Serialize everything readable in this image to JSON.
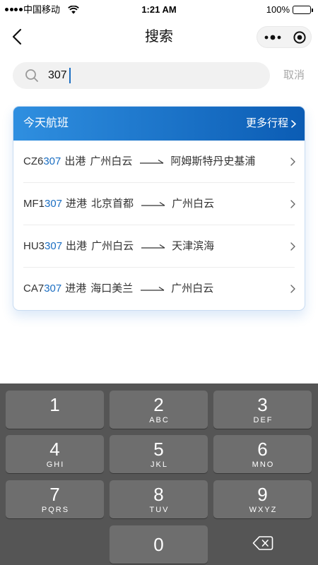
{
  "status_bar": {
    "carrier": "中国移动",
    "time": "1:21 AM",
    "battery_text": "100%",
    "battery_level": 1.0,
    "signal_icon": "signal-icon",
    "wifi_icon": "wifi-icon",
    "battery_icon": "battery-icon"
  },
  "nav": {
    "title": "搜索",
    "back_icon": "chevron-left-icon",
    "more_icon": "more-dots-icon",
    "close_icon": "target-circle-icon"
  },
  "search": {
    "icon": "search-icon",
    "value": "307",
    "cancel_label": "取消"
  },
  "flights_card": {
    "title": "今天航班",
    "more_label": "更多行程",
    "more_icon": "chevron-right-icon",
    "flights": [
      {
        "prefix": "CZ6",
        "match": "307",
        "direction": "出港",
        "origin": "广州白云",
        "destination": "阿姆斯特丹史基浦"
      },
      {
        "prefix": "MF1",
        "match": "307",
        "direction": "进港",
        "origin": "北京首都",
        "destination": "广州白云"
      },
      {
        "prefix": "HU3",
        "match": "307",
        "direction": "出港",
        "origin": "广州白云",
        "destination": "天津滨海"
      },
      {
        "prefix": "CA7",
        "match": "307",
        "direction": "进港",
        "origin": "海口美兰",
        "destination": "广州白云"
      }
    ]
  },
  "keyboard": {
    "keys": [
      {
        "digit": "1"
      },
      {
        "digit": "2",
        "letters": "ABC"
      },
      {
        "digit": "3",
        "letters": "DEF"
      },
      {
        "digit": "4",
        "letters": "GHI"
      },
      {
        "digit": "5",
        "letters": "JKL"
      },
      {
        "digit": "6",
        "letters": "MNO"
      },
      {
        "digit": "7",
        "letters": "PQRS"
      },
      {
        "digit": "8",
        "letters": "TUV"
      },
      {
        "digit": "9",
        "letters": "WXYZ"
      },
      {
        "digit": "0"
      }
    ],
    "delete_icon": "backspace-icon"
  },
  "colors": {
    "accent": "#1b6ec2",
    "header_gradient_start": "#2f8fe0",
    "header_gradient_end": "#0b5cb4",
    "keyboard_bg": "#555555",
    "key_bg": "#6e6e6e",
    "cancel_text": "#a8a8a8"
  }
}
